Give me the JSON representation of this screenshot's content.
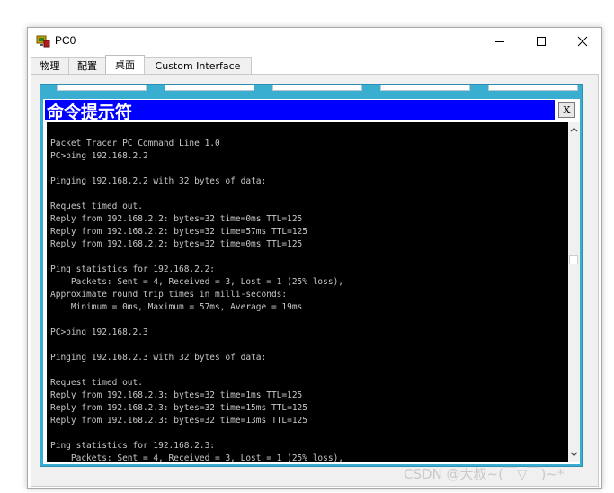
{
  "window": {
    "title": "PC0",
    "controls": {
      "minimize": "minimize-icon",
      "maximize": "maximize-icon",
      "close": "close-icon"
    }
  },
  "tabs": [
    {
      "label": "物理",
      "active": false
    },
    {
      "label": "配置",
      "active": false
    },
    {
      "label": "桌面",
      "active": true
    },
    {
      "label": "Custom Interface",
      "active": false
    }
  ],
  "command_prompt": {
    "title": "命令提示符",
    "close_label": "X",
    "title_bar_color": "#0000ff",
    "output": "Packet Tracer PC Command Line 1.0\nPC>ping 192.168.2.2\n\nPinging 192.168.2.2 with 32 bytes of data:\n\nRequest timed out.\nReply from 192.168.2.2: bytes=32 time=0ms TTL=125\nReply from 192.168.2.2: bytes=32 time=57ms TTL=125\nReply from 192.168.2.2: bytes=32 time=0ms TTL=125\n\nPing statistics for 192.168.2.2:\n    Packets: Sent = 4, Received = 3, Lost = 1 (25% loss),\nApproximate round trip times in milli-seconds:\n    Minimum = 0ms, Maximum = 57ms, Average = 19ms\n\nPC>ping 192.168.2.3\n\nPinging 192.168.2.3 with 32 bytes of data:\n\nRequest timed out.\nReply from 192.168.2.3: bytes=32 time=1ms TTL=125\nReply from 192.168.2.3: bytes=32 time=15ms TTL=125\nReply from 192.168.2.3: bytes=32 time=13ms TTL=125\n\nPing statistics for 192.168.2.3:\n    Packets: Sent = 4, Received = 3, Lost = 1 (25% loss),"
  },
  "desktop_background": "#3aaed0",
  "watermark": "CSDN @大叔~(￣▽￣)~*"
}
